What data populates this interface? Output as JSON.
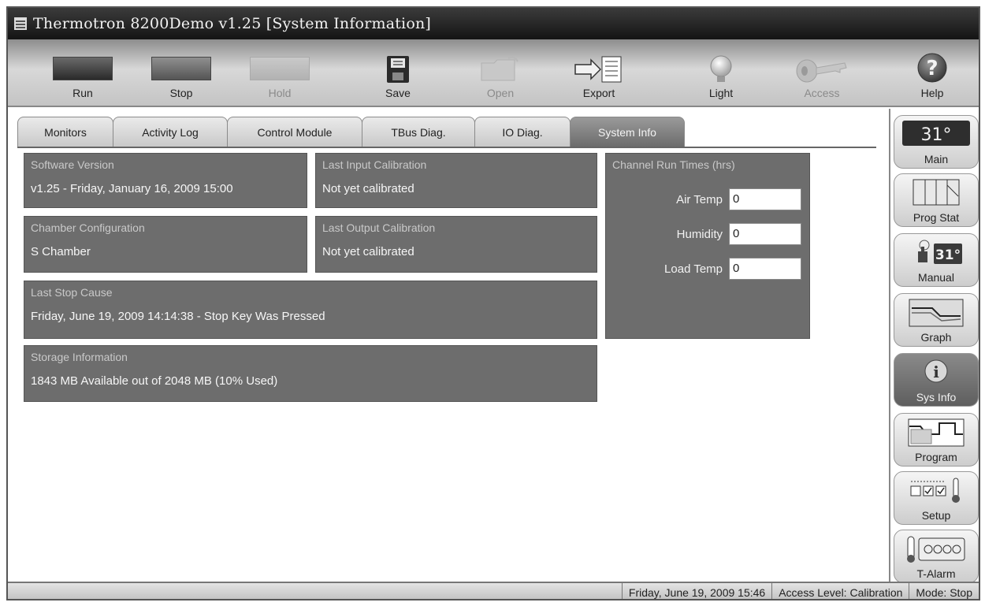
{
  "window": {
    "title": "Thermotron 8200Demo  v1.25 [System Information]"
  },
  "toolbar": {
    "run": "Run",
    "stop": "Stop",
    "hold": "Hold",
    "save": "Save",
    "open": "Open",
    "export": "Export",
    "light": "Light",
    "access": "Access",
    "help": "Help"
  },
  "tabs": [
    "Monitors",
    "Activity Log",
    "Control Module",
    "TBus Diag.",
    "IO Diag.",
    "System Info"
  ],
  "active_tab": "System Info",
  "panels": {
    "software_version": {
      "title": "Software Version",
      "value": "v1.25 - Friday, January 16, 2009 15:00"
    },
    "last_input_calibration": {
      "title": "Last Input Calibration",
      "value": "Not yet calibrated"
    },
    "chamber_configuration": {
      "title": "Chamber Configuration",
      "value": "S Chamber"
    },
    "last_output_calibration": {
      "title": "Last Output Calibration",
      "value": "Not yet calibrated"
    },
    "last_stop_cause": {
      "title": "Last Stop Cause",
      "value": "Friday, June 19, 2009 14:14:38 - Stop Key Was Pressed"
    },
    "storage_information": {
      "title": "Storage Information",
      "value": "1843 MB Available out of 2048 MB (10% Used)"
    },
    "channel_run_times": {
      "title": "Channel Run Times (hrs)",
      "rows": [
        {
          "label": "Air Temp",
          "value": "0"
        },
        {
          "label": "Humidity",
          "value": "0"
        },
        {
          "label": "Load Temp",
          "value": "0"
        }
      ]
    }
  },
  "sidebar": {
    "main_display": "31°",
    "manual_display": "31°",
    "items": [
      "Main",
      "Prog Stat",
      "Manual",
      "Graph",
      "Sys Info",
      "Program",
      "Setup",
      "T-Alarm"
    ],
    "active": "Sys Info"
  },
  "statusbar": {
    "datetime": "Friday, June 19, 2009 15:46",
    "access_level": "Access Level: Calibration",
    "mode": "Mode: Stop"
  },
  "icons": {
    "save": "floppy-disk-icon",
    "open": "folder-icon",
    "export": "export-arrow-icon",
    "light": "light-bulb-icon",
    "access": "key-icon",
    "help": "help-question-icon"
  }
}
